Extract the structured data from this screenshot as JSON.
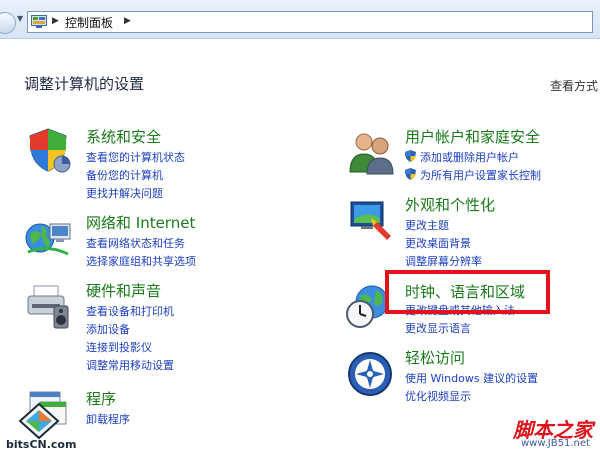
{
  "address_bar": {
    "breadcrumb": "控制面板"
  },
  "page": {
    "title": "调整计算机的设置",
    "view_by": "查看方式"
  },
  "categories": {
    "system": {
      "title": "系统和安全",
      "links": [
        "查看您的计算机状态",
        "备份您的计算机",
        "更找并解决问题"
      ]
    },
    "network": {
      "title": "网络和 Internet",
      "links": [
        "查看网络状态和任务",
        "选择家庭组和共享选项"
      ]
    },
    "hardware": {
      "title": "硬件和声音",
      "links": [
        "查看设备和打印机",
        "添加设备",
        "连接到投影仪",
        "调整常用移动设置"
      ]
    },
    "programs": {
      "title": "程序",
      "links": [
        "卸载程序"
      ]
    },
    "users": {
      "title": "用户帐户和家庭安全",
      "links": [
        "添加或删除用户帐户",
        "为所有用户设置家长控制"
      ]
    },
    "appearance": {
      "title": "外观和个性化",
      "links": [
        "更改主题",
        "更改桌面背景",
        "调整屏幕分辨率"
      ]
    },
    "clock": {
      "title": "时钟、语言和区域",
      "links": [
        "更改键盘或其他输入法",
        "更改显示语言"
      ]
    },
    "ease": {
      "title": "轻松访问",
      "links": [
        "使用 Windows 建议的设置",
        "优化视频显示"
      ]
    }
  },
  "watermarks": {
    "left": "bitsCN.com",
    "right_title": "脚本之家",
    "right_url": "www.JB51.net"
  },
  "colors": {
    "category_title": "#1a7a1a",
    "link": "#1c3fbf",
    "highlight": "#e0121b"
  }
}
